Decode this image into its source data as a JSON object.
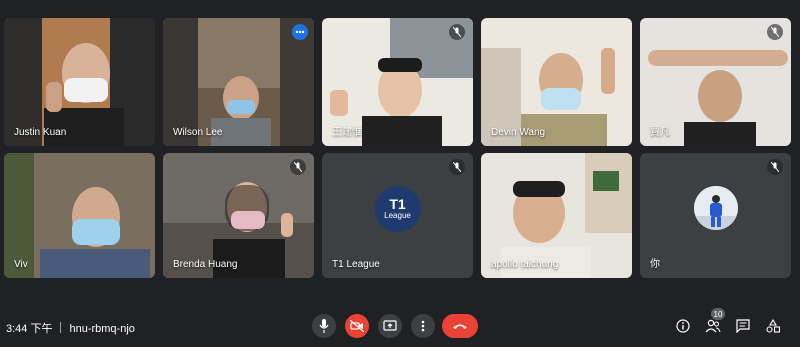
{
  "participants": [
    {
      "name": "Justin Kuan",
      "muted": false
    },
    {
      "name": "Wilson Lee",
      "muted": false,
      "speaking": true
    },
    {
      "name": "王建惟",
      "muted": true
    },
    {
      "name": "Devin Wang",
      "muted": false
    },
    {
      "name": "賈凡",
      "muted": true
    },
    {
      "name": "Viv",
      "muted": false
    },
    {
      "name": "Brenda Huang",
      "muted": true
    },
    {
      "name": "T1 League",
      "muted": true,
      "avatar_big": "T1",
      "avatar_small": "League"
    },
    {
      "name": "apollo taichung",
      "muted": false
    },
    {
      "name": "你",
      "muted": true
    }
  ],
  "bottom_bar": {
    "time": "3:44 下午",
    "meeting_code": "hnu-rbmq-njo",
    "people_count": "10"
  },
  "colors": {
    "background": "#202124",
    "tile": "#3c4043",
    "accent": "#1a73e8",
    "danger": "#ea4335"
  },
  "icons": [
    "mic-icon",
    "camera-off-icon",
    "present-screen-icon",
    "more-options-icon",
    "hang-up-icon",
    "info-icon",
    "people-icon",
    "chat-icon",
    "activities-icon"
  ]
}
